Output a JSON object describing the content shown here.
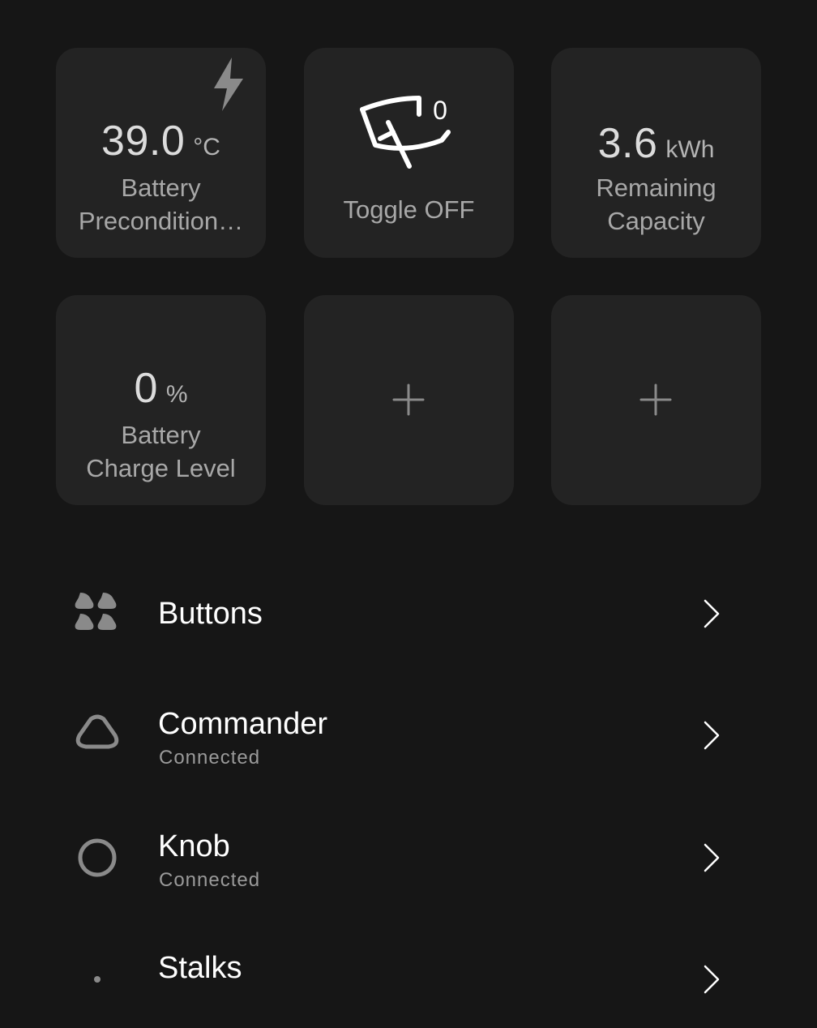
{
  "tiles": {
    "precondition": {
      "value": "39.0",
      "unit": "°C",
      "label_line1": "Battery",
      "label_line2": "Precondition…",
      "icon": "bolt-icon"
    },
    "wiper": {
      "badge": "0",
      "label": "Toggle OFF",
      "icon": "windshield-wiper-icon"
    },
    "capacity": {
      "value": "3.6",
      "unit": "kWh",
      "label_line1": "Remaining",
      "label_line2": "Capacity"
    },
    "charge": {
      "value": "0",
      "unit": "%",
      "label_line1": "Battery",
      "label_line2": "Charge Level"
    },
    "empty": [
      {
        "icon": "plus-icon"
      },
      {
        "icon": "plus-icon"
      }
    ]
  },
  "list": [
    {
      "title": "Buttons",
      "subtitle": "",
      "icon": "buttons-icon"
    },
    {
      "title": "Commander",
      "subtitle": "Connected",
      "icon": "commander-icon"
    },
    {
      "title": "Knob",
      "subtitle": "Connected",
      "icon": "knob-icon"
    },
    {
      "title": "Stalks",
      "subtitle": "",
      "icon": "stalks-icon"
    }
  ],
  "colors": {
    "background": "#161616",
    "tile": "#232323",
    "text_primary": "#ffffff",
    "text_secondary": "#a8a8a8",
    "icon_gray": "#8a8a8a"
  }
}
